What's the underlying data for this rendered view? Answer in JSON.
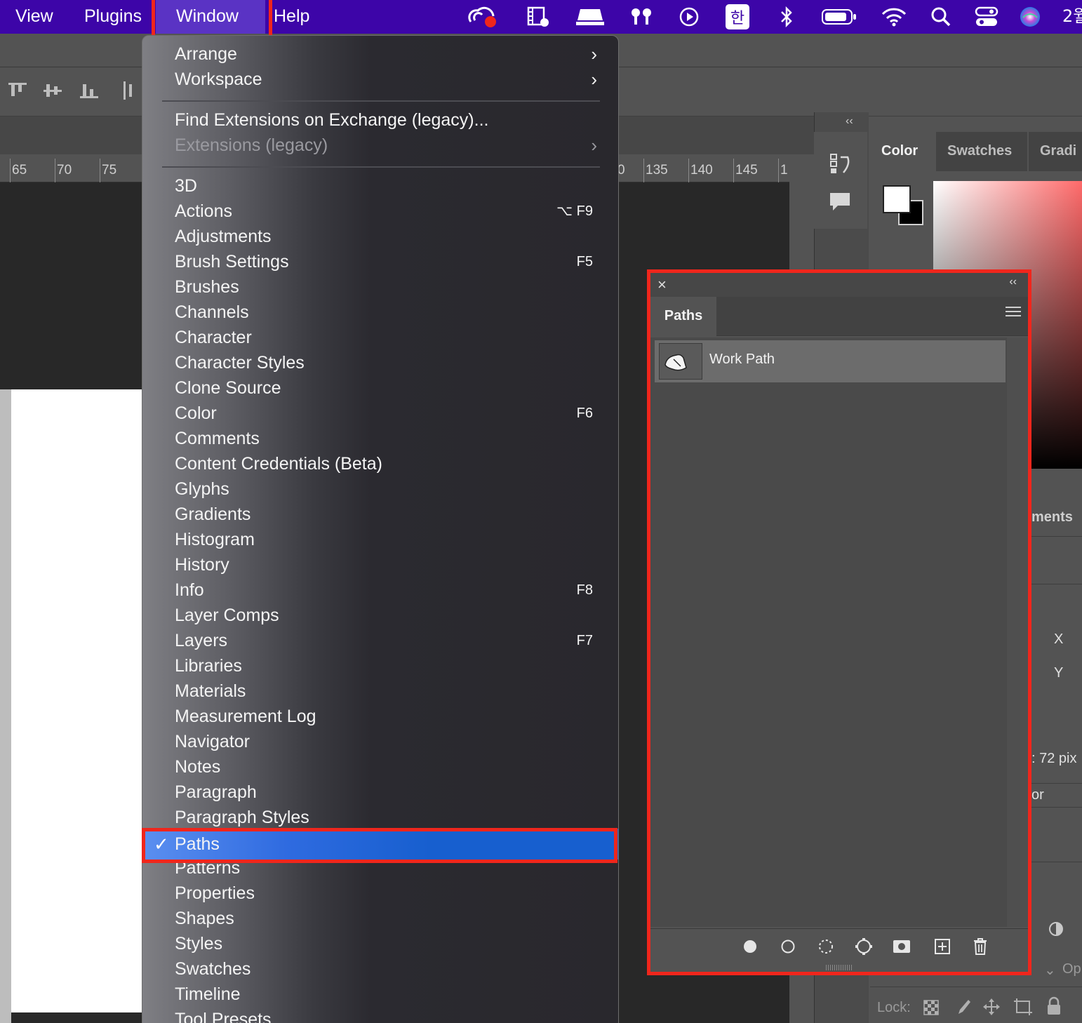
{
  "menubar": {
    "items": [
      "View",
      "Plugins",
      "Window",
      "Help"
    ],
    "active": "Window",
    "time_partial": "2월",
    "icons": [
      "creative-cloud-icon",
      "screen-recorder-icon",
      "display-icon",
      "airpods-icon",
      "play-icon",
      "korean-input-icon",
      "bluetooth-icon",
      "battery-icon",
      "wifi-icon",
      "spotlight-search-icon",
      "control-center-icon",
      "siri-icon"
    ]
  },
  "ruler": {
    "left": [
      "65",
      "70",
      "75"
    ],
    "right": [
      "0",
      "135",
      "140",
      "145",
      "1"
    ]
  },
  "window_menu": {
    "section1": [
      {
        "label": "Arrange",
        "submenu": true
      },
      {
        "label": "Workspace",
        "submenu": true
      }
    ],
    "section2": [
      {
        "label": "Find Extensions on Exchange (legacy)...",
        "disabled": false
      },
      {
        "label": "Extensions (legacy)",
        "disabled": true,
        "submenu": true
      }
    ],
    "section3": [
      {
        "label": "3D",
        "shortcut": ""
      },
      {
        "label": "Actions",
        "shortcut": "⌥ F9"
      },
      {
        "label": "Adjustments",
        "shortcut": ""
      },
      {
        "label": "Brush Settings",
        "shortcut": "F5"
      },
      {
        "label": "Brushes",
        "shortcut": ""
      },
      {
        "label": "Channels",
        "shortcut": ""
      },
      {
        "label": "Character",
        "shortcut": ""
      },
      {
        "label": "Character Styles",
        "shortcut": ""
      },
      {
        "label": "Clone Source",
        "shortcut": ""
      },
      {
        "label": "Color",
        "shortcut": "F6"
      },
      {
        "label": "Comments",
        "shortcut": ""
      },
      {
        "label": "Content Credentials (Beta)",
        "shortcut": ""
      },
      {
        "label": "Glyphs",
        "shortcut": ""
      },
      {
        "label": "Gradients",
        "shortcut": ""
      },
      {
        "label": "Histogram",
        "shortcut": ""
      },
      {
        "label": "History",
        "shortcut": ""
      },
      {
        "label": "Info",
        "shortcut": "F8"
      },
      {
        "label": "Layer Comps",
        "shortcut": ""
      },
      {
        "label": "Layers",
        "shortcut": "F7"
      },
      {
        "label": "Libraries",
        "shortcut": ""
      },
      {
        "label": "Materials",
        "shortcut": ""
      },
      {
        "label": "Measurement Log",
        "shortcut": ""
      },
      {
        "label": "Navigator",
        "shortcut": ""
      },
      {
        "label": "Notes",
        "shortcut": ""
      },
      {
        "label": "Paragraph",
        "shortcut": ""
      },
      {
        "label": "Paragraph Styles",
        "shortcut": ""
      },
      {
        "label": "Paths",
        "shortcut": "",
        "checked": true,
        "highlighted": true
      },
      {
        "label": "Patterns",
        "shortcut": ""
      },
      {
        "label": "Properties",
        "shortcut": ""
      },
      {
        "label": "Shapes",
        "shortcut": ""
      },
      {
        "label": "Styles",
        "shortcut": ""
      },
      {
        "label": "Swatches",
        "shortcut": ""
      },
      {
        "label": "Timeline",
        "shortcut": ""
      },
      {
        "label": "Tool Presets",
        "shortcut": ""
      }
    ],
    "checkmark": "✓"
  },
  "paths_panel": {
    "tab": "Paths",
    "rows": [
      {
        "name": "Work Path"
      }
    ],
    "footer_buttons": [
      "fill-path-button",
      "stroke-path-button",
      "load-as-selection-button",
      "make-work-path-button",
      "add-mask-button",
      "new-path-button",
      "delete-path-button"
    ]
  },
  "color_panel": {
    "tabs": [
      "Color",
      "Swatches",
      "Gradi"
    ],
    "foreground": "#ffffff",
    "background": "#000000"
  },
  "properties_panel": {
    "partial_tab": "ments",
    "x_label": "X",
    "y_label": "Y",
    "resolution_partial": ": 72 pix",
    "partial_or": "or",
    "partial_op": "Op",
    "lock_label": "Lock:"
  },
  "colors": {
    "menubar_bg": "#3d05a8",
    "highlight_red": "#f0261c",
    "selection_blue": "#175fcf"
  }
}
